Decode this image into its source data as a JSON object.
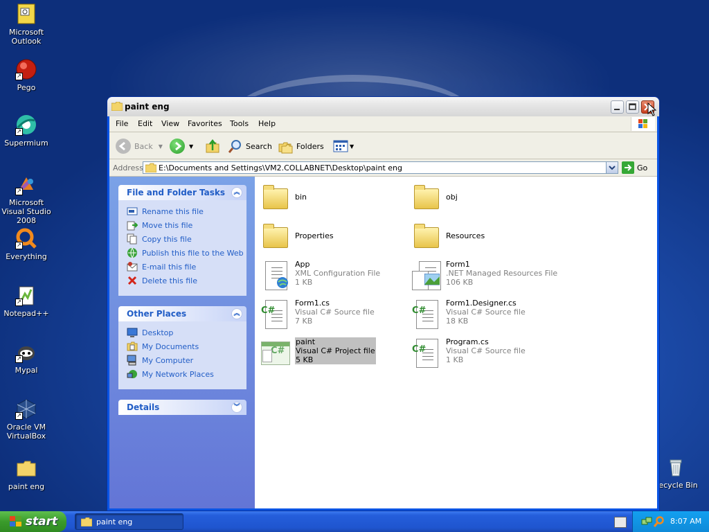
{
  "desktop": {
    "icons": [
      {
        "label": "Microsoft Outlook",
        "icon": "outlook-icon"
      },
      {
        "label": "Pego",
        "icon": "pego-icon"
      },
      {
        "label": "Supermium",
        "icon": "supermium-icon"
      },
      {
        "label": "Microsoft Visual Studio 2008",
        "icon": "visual-studio-icon"
      },
      {
        "label": "Everything",
        "icon": "everything-icon"
      },
      {
        "label": "Notepad++",
        "icon": "notepadpp-icon"
      },
      {
        "label": "Mypal",
        "icon": "mypal-icon"
      },
      {
        "label": "Oracle VM VirtualBox",
        "icon": "virtualbox-icon"
      },
      {
        "label": "paint eng",
        "icon": "folder-icon"
      },
      {
        "label": "Recycle Bin",
        "icon": "recycle-bin-icon"
      }
    ]
  },
  "window": {
    "title": "paint eng",
    "menu": [
      "File",
      "Edit",
      "View",
      "Favorites",
      "Tools",
      "Help"
    ],
    "toolbar": {
      "back": "Back",
      "search": "Search",
      "folders": "Folders"
    },
    "address": {
      "label": "Address",
      "path": "E:\\Documents and Settings\\VM2.COLLABNET\\Desktop\\paint eng",
      "go": "Go"
    },
    "file_tasks": {
      "title": "File and Folder Tasks",
      "items": [
        "Rename this file",
        "Move this file",
        "Copy this file",
        "Publish this file to the Web",
        "E-mail this file",
        "Delete this file"
      ]
    },
    "other_places": {
      "title": "Other Places",
      "items": [
        "Desktop",
        "My Documents",
        "My Computer",
        "My Network Places"
      ]
    },
    "details": {
      "title": "Details"
    },
    "files": [
      {
        "name": "bin",
        "type": "",
        "size": "",
        "icon": "folder-icon"
      },
      {
        "name": "obj",
        "type": "",
        "size": "",
        "icon": "folder-icon"
      },
      {
        "name": "Properties",
        "type": "",
        "size": "",
        "icon": "folder-icon"
      },
      {
        "name": "Resources",
        "type": "",
        "size": "",
        "icon": "folder-icon"
      },
      {
        "name": "App",
        "type": "XML Configuration File",
        "size": "1 KB",
        "icon": "xml-config-icon"
      },
      {
        "name": "Form1",
        "type": ".NET Managed Resources File",
        "size": "106 KB",
        "icon": "resx-icon"
      },
      {
        "name": "Form1.cs",
        "type": "Visual C# Source file",
        "size": "7 KB",
        "icon": "csharp-file-icon"
      },
      {
        "name": "Form1.Designer.cs",
        "type": "Visual C# Source file",
        "size": "18 KB",
        "icon": "csharp-file-icon"
      },
      {
        "name": "paint",
        "type": "Visual C# Project file",
        "size": "5 KB",
        "icon": "csproj-icon",
        "selected": true
      },
      {
        "name": "Program.cs",
        "type": "Visual C# Source file",
        "size": "1 KB",
        "icon": "csharp-file-icon"
      }
    ]
  },
  "taskbar": {
    "start": "start",
    "task": "paint eng",
    "clock": "8:07 AM"
  },
  "colors": {
    "task_link": "#215dc6",
    "pane_gradient_top": "#7ba2e7",
    "selection": "#c0c0c0"
  }
}
